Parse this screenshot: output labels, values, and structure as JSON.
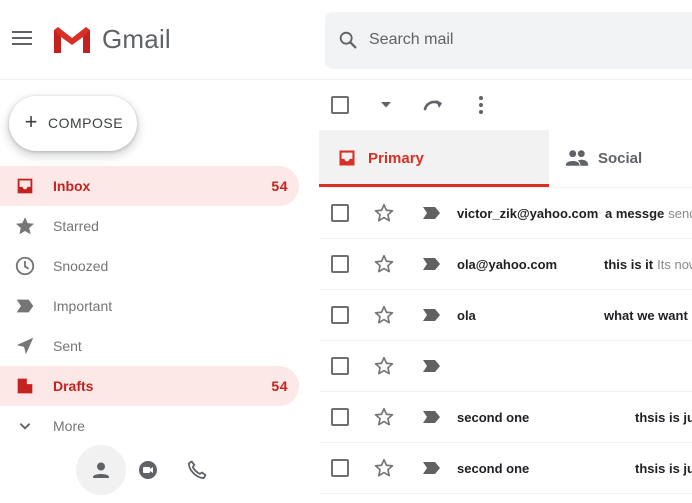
{
  "app": {
    "name": "Gmail",
    "brand_color": "#d93025"
  },
  "search": {
    "placeholder": "Search mail"
  },
  "compose": {
    "label": "COMPOSE"
  },
  "sidebar": {
    "items": [
      {
        "label": "Inbox",
        "count": "54",
        "icon": "inbox-icon",
        "active": true
      },
      {
        "label": "Starred",
        "count": "",
        "icon": "star-icon",
        "active": false
      },
      {
        "label": "Snoozed",
        "count": "",
        "icon": "clock-icon",
        "active": false
      },
      {
        "label": "Important",
        "count": "",
        "icon": "important-icon",
        "active": false
      },
      {
        "label": "Sent",
        "count": "",
        "icon": "send-icon",
        "active": false
      },
      {
        "label": "Drafts",
        "count": "54",
        "icon": "draft-icon",
        "active": true
      },
      {
        "label": "More",
        "count": "",
        "icon": "chevron-down-icon",
        "active": false
      }
    ],
    "bottom_icons": [
      "person-icon",
      "meet-icon",
      "phone-icon"
    ]
  },
  "toolbar": {
    "icons": [
      "select-all-checkbox",
      "caret-down-icon",
      "refresh-icon",
      "more-vert-icon"
    ]
  },
  "tabs": [
    {
      "label": "Primary",
      "icon": "inbox-icon",
      "selected": true
    },
    {
      "label": "Social",
      "icon": "people-icon",
      "selected": false
    }
  ],
  "emails": [
    {
      "sender": "victor_zik@yahoo.com",
      "subject": "a messge",
      "snippet": "send"
    },
    {
      "sender": "ola@yahoo.com",
      "subject": "this is it",
      "snippet": "Its now"
    },
    {
      "sender": "ola",
      "subject": "what we want",
      "snippet": ""
    },
    {
      "sender": "",
      "subject": "",
      "snippet": ""
    },
    {
      "sender": "second one",
      "subject": "thsis is jus",
      "snippet": ""
    },
    {
      "sender": "second one",
      "subject": "thsis is jus",
      "snippet": ""
    }
  ]
}
